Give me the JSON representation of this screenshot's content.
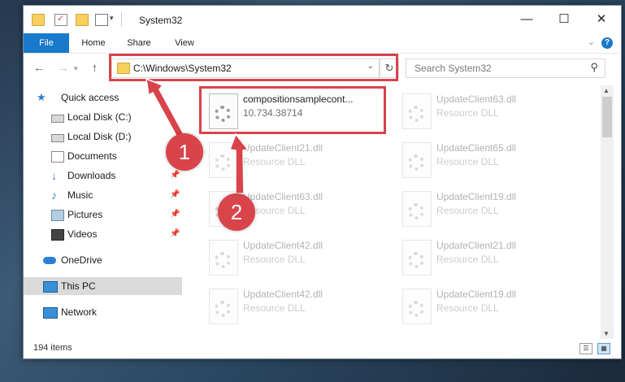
{
  "window": {
    "title": "System32",
    "controls": {
      "minimize": "—",
      "maximize": "☐",
      "close": "✕"
    }
  },
  "ribbon": {
    "tabs": [
      "File",
      "Home",
      "Share",
      "View"
    ],
    "help": "?"
  },
  "navigation": {
    "back": "←",
    "forward": "→",
    "up": "↑",
    "address": "C:\\Windows\\System32",
    "search_placeholder": "Search System32"
  },
  "sidebar": {
    "items": [
      {
        "label": "Quick access",
        "icon": "star-icon"
      },
      {
        "label": "Local Disk (C:)",
        "icon": "drive-icon"
      },
      {
        "label": "Local Disk (D:)",
        "icon": "drive-icon"
      },
      {
        "label": "Documents",
        "icon": "documents-icon"
      },
      {
        "label": "Downloads",
        "icon": "download-icon",
        "pinned": true
      },
      {
        "label": "Music",
        "icon": "music-icon",
        "pinned": true
      },
      {
        "label": "Pictures",
        "icon": "pictures-icon",
        "pinned": true
      },
      {
        "label": "Videos",
        "icon": "videos-icon",
        "pinned": true
      },
      {
        "label": "OneDrive",
        "icon": "cloud-icon"
      },
      {
        "label": "This PC",
        "icon": "computer-icon",
        "selected": true
      },
      {
        "label": "Network",
        "icon": "network-icon"
      }
    ]
  },
  "files": [
    {
      "name": "compositionsamplecont...",
      "desc": "10.734.38714"
    },
    {
      "name": "UpdateClient63.dll",
      "desc": "Resource DLL"
    },
    {
      "name": "UpdateClient21.dll",
      "desc": "Resource DLL"
    },
    {
      "name": "UpdateClient65.dll",
      "desc": "Resource DLL"
    },
    {
      "name": "UpdateClient63.dll",
      "desc": "Resource DLL"
    },
    {
      "name": "UpdateClient19.dll",
      "desc": "Resource DLL"
    },
    {
      "name": "UpdateClient42.dll",
      "desc": "Resource DLL"
    },
    {
      "name": "UpdateClient21.dll",
      "desc": "Resource DLL"
    },
    {
      "name": "UpdateClient42.dll",
      "desc": "Resource DLL"
    },
    {
      "name": "UpdateClient19.dll",
      "desc": "Resource DLL"
    }
  ],
  "status": {
    "items": "194 items"
  },
  "annotations": {
    "step1": "1",
    "step2": "2",
    "color": "#d9434a"
  }
}
